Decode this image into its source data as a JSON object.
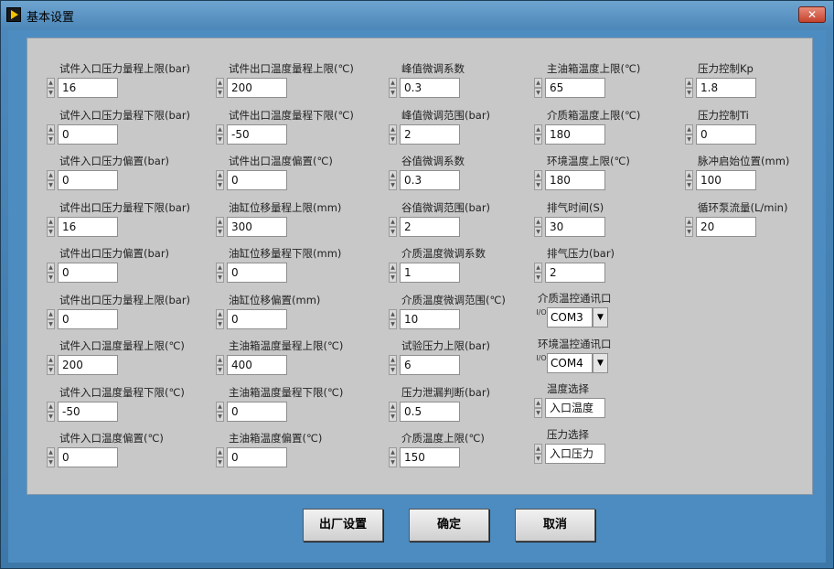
{
  "window": {
    "title": "基本设置",
    "close_label": "✕"
  },
  "columns": [
    [
      {
        "label": "试件入口压力量程上限(bar)",
        "value": "16"
      },
      {
        "label": "试件入口压力量程下限(bar)",
        "value": "0"
      },
      {
        "label": "试件入口压力偏置(bar)",
        "value": "0"
      },
      {
        "label": "试件出口压力量程下限(bar)",
        "value": "16"
      },
      {
        "label": "试件出口压力偏置(bar)",
        "value": "0"
      },
      {
        "label": "试件出口压力量程上限(bar)",
        "value": "0"
      },
      {
        "label": "试件入口温度量程上限(℃)",
        "value": "200"
      },
      {
        "label": "试件入口温度量程下限(℃)",
        "value": "-50"
      },
      {
        "label": "试件入口温度偏置(℃)",
        "value": "0"
      }
    ],
    [
      {
        "label": "试件出口温度量程上限(℃)",
        "value": "200"
      },
      {
        "label": "试件出口温度量程下限(℃)",
        "value": "-50"
      },
      {
        "label": "试件出口温度偏置(℃)",
        "value": "0"
      },
      {
        "label": "油缸位移量程上限(mm)",
        "value": "300"
      },
      {
        "label": "油缸位移量程下限(mm)",
        "value": "0"
      },
      {
        "label": "油缸位移偏置(mm)",
        "value": "0"
      },
      {
        "label": "主油箱温度量程上限(℃)",
        "value": "400"
      },
      {
        "label": "主油箱温度量程下限(℃)",
        "value": "0"
      },
      {
        "label": "主油箱温度偏置(℃)",
        "value": "0"
      }
    ],
    [
      {
        "label": "峰值微调系数",
        "value": "0.3"
      },
      {
        "label": "峰值微调范围(bar)",
        "value": "2"
      },
      {
        "label": "谷值微调系数",
        "value": "0.3"
      },
      {
        "label": "谷值微调范围(bar)",
        "value": "2"
      },
      {
        "label": "介质温度微调系数",
        "value": "1"
      },
      {
        "label": "介质温度微调范围(℃)",
        "value": "10"
      },
      {
        "label": "试验压力上限(bar)",
        "value": "6"
      },
      {
        "label": "压力泄漏判断(bar)",
        "value": "0.5"
      },
      {
        "label": "介质温度上限(℃)",
        "value": "150"
      }
    ],
    [
      {
        "label": "主油箱温度上限(℃)",
        "value": "65"
      },
      {
        "label": "介质箱温度上限(℃)",
        "value": "180"
      },
      {
        "label": "环境温度上限(℃)",
        "value": "180"
      },
      {
        "label": "排气时间(S)",
        "value": "30"
      },
      {
        "label": "排气压力(bar)",
        "value": "2"
      }
    ],
    [
      {
        "label": "压力控制Kp",
        "value": "1.8"
      },
      {
        "label": "压力控制Ti",
        "value": "0"
      },
      {
        "label": "脉冲启始位置(mm)",
        "value": "100"
      },
      {
        "label": "循环泵流量(L/min)",
        "value": "20"
      }
    ]
  ],
  "combos": [
    {
      "label": "介质温控通讯口",
      "value": "COM3",
      "tag": "I/O"
    },
    {
      "label": "环境温控通讯口",
      "value": "COM4",
      "tag": "I/O"
    }
  ],
  "selects": [
    {
      "label": "温度选择",
      "value": "入口温度"
    },
    {
      "label": "压力选择",
      "value": "入口压力"
    }
  ],
  "buttons": {
    "factory": "出厂设置",
    "ok": "确定",
    "cancel": "取消"
  }
}
